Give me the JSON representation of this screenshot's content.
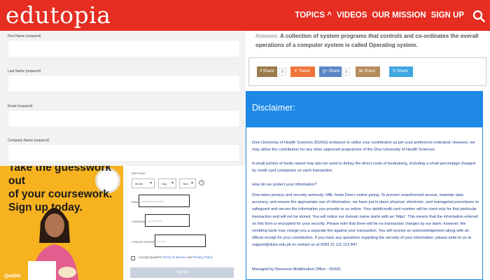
{
  "header": {
    "logo": "edutopia",
    "nav": [
      "TOPICS ^",
      "VIDEOS",
      "OUR MISSION",
      "SIGN UP"
    ],
    "bg_color": "#e52d21"
  },
  "form": {
    "fields": [
      {
        "label": "First Name (required)",
        "value": ""
      },
      {
        "label": "Last Name (required)",
        "value": ""
      },
      {
        "label": "Email (required)",
        "value": ""
      },
      {
        "label": "Company Name (required)",
        "value": ""
      }
    ]
  },
  "ad": {
    "line1": "Take the guesswork out",
    "line2": "of your coursework.",
    "line3": "Sign up today.",
    "brand": "Quizlet",
    "birthday_label": "BIRTHDAY",
    "month": "Month",
    "day": "Day",
    "year": "Year",
    "email_label": "EMAIL",
    "email_placeholder": "user@quizlet.com",
    "username_label": "USERNAME",
    "username_placeholder": "andrew123",
    "password_label": "CREATE PASSWORD",
    "password_placeholder": "••••••••",
    "agree_prefix": "I accept Quizlet's",
    "tos": "Terms of Service",
    "and": "and",
    "privacy": "Privacy Policy",
    "signup": "Sign up",
    "bg_color": "#f6b21f"
  },
  "answer": {
    "prefix": "Answers:",
    "text": "A collection of system programs that controls and co-ordinates the overall operations of a computer system is called Operating system."
  },
  "share": [
    {
      "label": "Share",
      "color": "#9a7a4a",
      "count": "0",
      "icon": "facebook-icon"
    },
    {
      "label": "Tweet",
      "color": "#f0753a",
      "count": null,
      "icon": "twitter-icon"
    },
    {
      "label": "Share",
      "color": "#5a86c6",
      "count": "0",
      "icon": "googleplus-icon"
    },
    {
      "label": "Share",
      "color": "#b58c5b",
      "count": null,
      "icon": "linkedin-icon"
    },
    {
      "label": "Share",
      "color": "#41a6e0",
      "count": null,
      "icon": "skype-icon"
    }
  ],
  "disclaimer": {
    "title": "Disclaimer:",
    "color": "#1e88e5",
    "paragraphs": [
      "Dow University of Health Sciences (DUHS) endeavor to utilize your contribution as per your preference indicated. However, we may utilise the contribution for any other approved programme of the Dow University of Health Sciences.",
      "A small portion of funds raised may also be used to defray the direct costs of fundraising, including a small percentage charged by credit card companies on each transaction.",
      "How do we protect your information?",
      "Dow takes privacy and security seriously. HBL hosts Dow's online giving. To prevent unauthorized access, maintain data accuracy, and ensure the appropriate use of information, we have put in place physical, electronic, and managerial procedures to safeguard and secure the information you provide to us online. Your debit/credit card number will be used only for that particular transaction and will not be stored. You will notice our domain name starts with an 'https'. This means that the information entered on this form is encrypted for your security. Please note that there will be no transaction charges by our bank; however, the remitting bank may charge you a separate fee against your transaction. You will receive an acknowledgement along with an official receipt for your contribution. If you have any questions regarding the security of your information, please write to us at support@duhs.edu.pk or contact us at 0092 21 111 113 847",
      "Managed by Resource Mobilization Office - DUHS."
    ]
  }
}
